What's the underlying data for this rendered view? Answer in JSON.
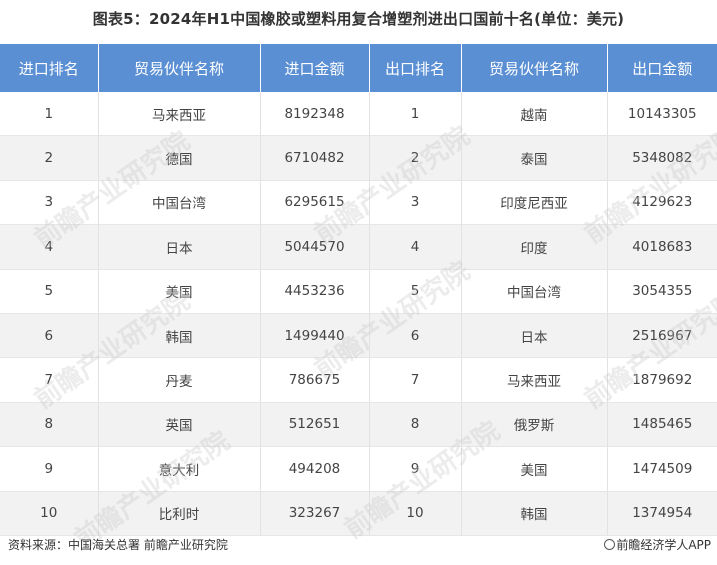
{
  "title": "图表5：2024年H1中国橡胶或塑料用复合增塑剂进出口国前十名(单位：美元)",
  "table": {
    "headers": [
      "进口排名",
      "贸易伙伴名称",
      "进口金额",
      "出口排名",
      "贸易伙伴名称",
      "出口金额"
    ],
    "rows": [
      [
        "1",
        "马来西亚",
        "8192348",
        "1",
        "越南",
        "10143305"
      ],
      [
        "2",
        "德国",
        "6710482",
        "2",
        "泰国",
        "5348082"
      ],
      [
        "3",
        "中国台湾",
        "6295615",
        "3",
        "印度尼西亚",
        "4129623"
      ],
      [
        "4",
        "日本",
        "5044570",
        "4",
        "印度",
        "4018683"
      ],
      [
        "5",
        "美国",
        "4453236",
        "5",
        "中国台湾",
        "3054355"
      ],
      [
        "6",
        "韩国",
        "1499440",
        "6",
        "日本",
        "2516967"
      ],
      [
        "7",
        "丹麦",
        "786675",
        "7",
        "马来西亚",
        "1879692"
      ],
      [
        "8",
        "英国",
        "512651",
        "8",
        "俄罗斯",
        "1485465"
      ],
      [
        "9",
        "意大利",
        "494208",
        "9",
        "美国",
        "1474509"
      ],
      [
        "10",
        "比利时",
        "323267",
        "10",
        "韩国",
        "1374954"
      ]
    ]
  },
  "footer": {
    "source": "资料来源：中国海关总署 前瞻产业研究院",
    "brand": "前瞻经济学人APP"
  },
  "watermark_text": "前瞻产业研究院",
  "colors": {
    "header_bg": "#5b8fd4",
    "stripe_bg": "#f2f2f2"
  }
}
